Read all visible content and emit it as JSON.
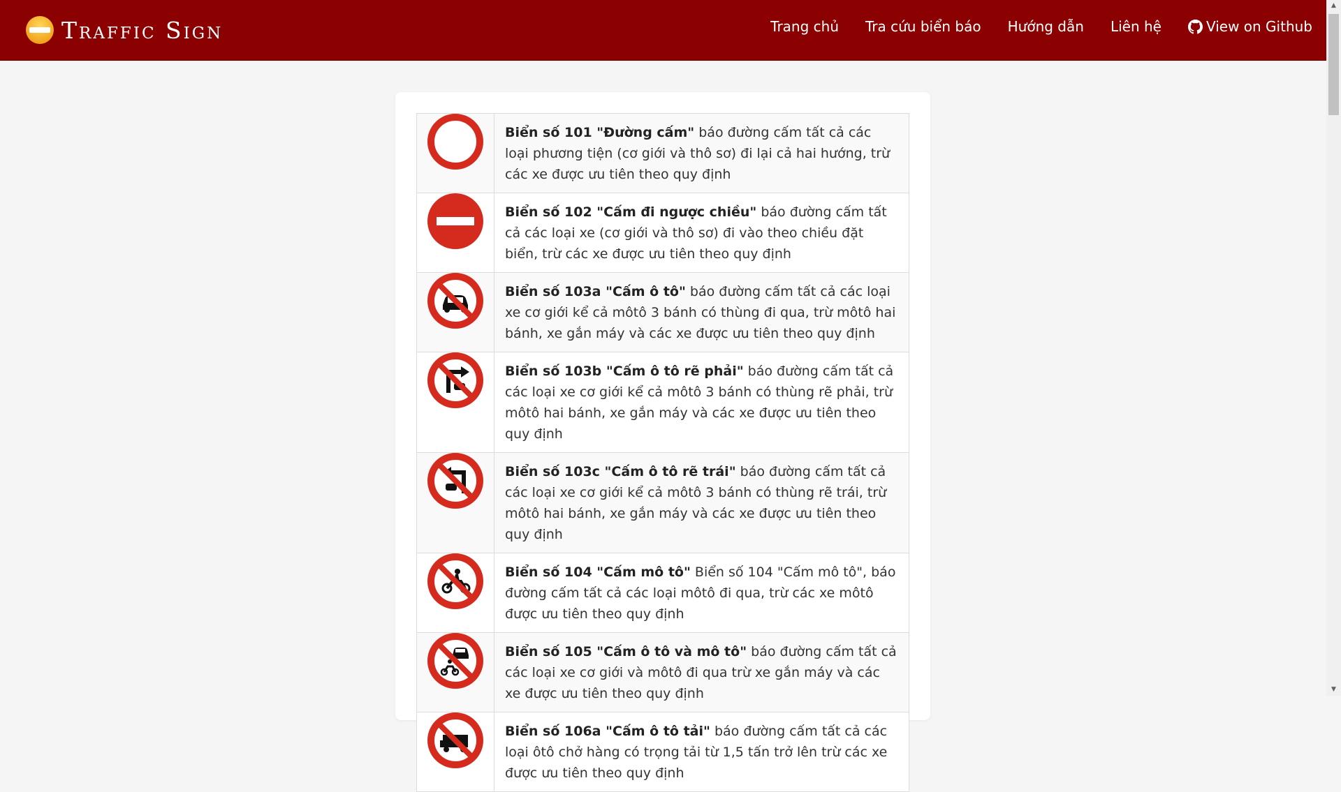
{
  "brand": {
    "name": "Traffic Sign"
  },
  "nav": {
    "home": "Trang chủ",
    "lookup": "Tra cứu biển báo",
    "guide": "Hướng dẫn",
    "contact": "Liên hệ",
    "github": "View on Github"
  },
  "signs": [
    {
      "title": "Biển số 101 \"Đường cấm\"",
      "description": "báo đường cấm tất cả các loại phương tiện (cơ giới và thô sơ) đi lại cả hai hướng, trừ các xe được ưu tiên theo quy định"
    },
    {
      "title": "Biển số 102 \"Cấm đi ngược chiều\"",
      "description": "báo đường cấm tất cả các loại xe (cơ giới và thô sơ) đi vào theo chiều đặt biển, trừ các xe được ưu tiên theo quy định"
    },
    {
      "title": "Biển số 103a \"Cấm ô tô\"",
      "description": "báo đường cấm tất cả các loại xe cơ giới kể cả môtô 3 bánh có thùng đi qua, trừ môtô hai bánh, xe gắn máy và các xe được ưu tiên theo quy định"
    },
    {
      "title": "Biển số 103b \"Cấm ô tô rẽ phải\"",
      "description": "báo đường cấm tất cả các loại xe cơ giới kể cả môtô 3 bánh có thùng rẽ phải, trừ môtô hai bánh, xe gắn máy và các xe được ưu tiên theo quy định"
    },
    {
      "title": "Biển số 103c \"Cấm ô tô rẽ trái\"",
      "description": "báo đường cấm tất cả các loại xe cơ giới kể cả môtô 3 bánh có thùng rẽ trái, trừ môtô hai bánh, xe gắn máy và các xe được ưu tiên theo quy định"
    },
    {
      "title": "Biển số 104 \"Cấm mô tô\"",
      "description": "Biển số 104 \"Cấm mô tô\", báo đường cấm tất cả các loại môtô đi qua, trừ các xe môtô được ưu tiên theo quy định"
    },
    {
      "title": "Biển số 105 \"Cấm ô tô và mô tô\"",
      "description": "báo đường cấm tất cả các loại xe cơ giới và môtô đi qua trừ xe gắn máy và các xe được ưu tiên theo quy định"
    },
    {
      "title": "Biển số 106a \"Cấm ô tô tải\"",
      "description": "báo đường cấm tất cả các loại ôtô chở hàng có trọng tải từ 1,5 tấn trở lên trừ các xe được ưu tiên theo quy định"
    }
  ],
  "icons": {
    "logo": "no-entry-logo-icon",
    "github": "github-icon",
    "signs": [
      "sign-101-no-vehicles-icon",
      "sign-102-no-entry-icon",
      "sign-103a-no-cars-icon",
      "sign-103b-no-cars-right-turn-icon",
      "sign-103c-no-cars-left-turn-icon",
      "sign-104-no-motorcycles-icon",
      "sign-105-no-cars-motorcycles-icon",
      "sign-106a-no-trucks-icon"
    ]
  },
  "colors": {
    "navbar": "#8b0000",
    "sign_red": "#d52b1e",
    "background": "#f5f5f5"
  }
}
